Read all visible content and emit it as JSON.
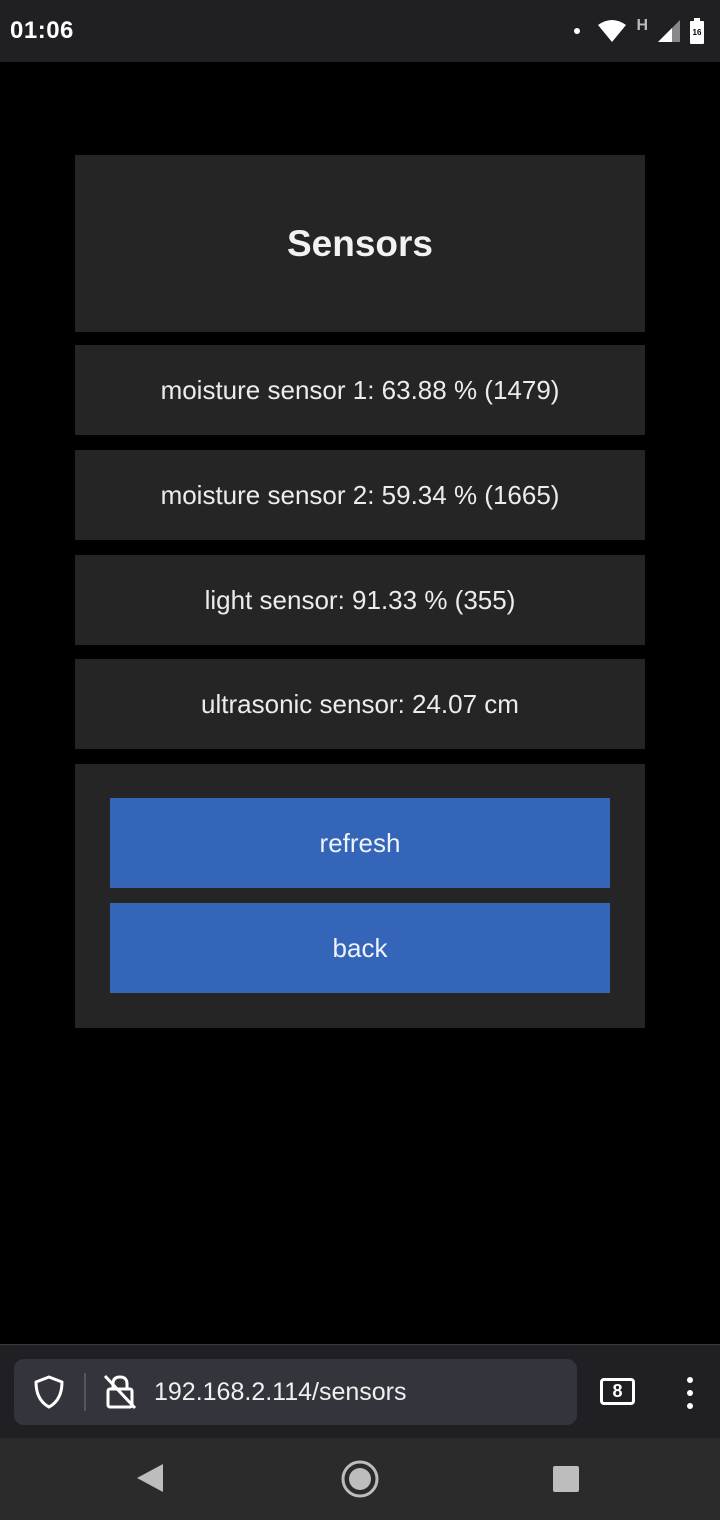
{
  "status_bar": {
    "time": "01:06",
    "network_label": "H",
    "battery_level": "16"
  },
  "page": {
    "title": "Sensors",
    "sensors": [
      {
        "label": "moisture sensor 1: 63.88 % (1479)"
      },
      {
        "label": "moisture sensor 2: 59.34 % (1665)"
      },
      {
        "label": "light sensor: 91.33 % (355)"
      },
      {
        "label": "ultrasonic sensor: 24.07 cm"
      }
    ],
    "buttons": {
      "refresh": "refresh",
      "back": "back"
    }
  },
  "browser": {
    "url": "192.168.2.114/sensors",
    "tab_count": "8"
  },
  "colors": {
    "accent": "#3565b8",
    "card": "#252525",
    "background": "#000000"
  }
}
